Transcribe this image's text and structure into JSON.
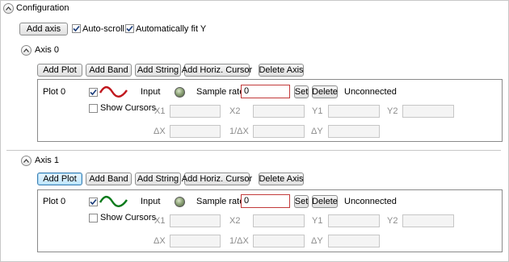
{
  "configuration": {
    "title": "Configuration",
    "add_axis_label": "Add axis",
    "auto_scroll_label": "Auto-scroll",
    "auto_scroll_checked": true,
    "auto_fit_label": "Automatically fit Y",
    "auto_fit_checked": true
  },
  "axes": [
    {
      "title": "Axis 0",
      "buttons": {
        "add_plot": "Add Plot",
        "add_band": "Add Band",
        "add_string": "Add String",
        "add_cursor": "Add Horiz. Cursor",
        "delete_axis": "Delete Axis"
      },
      "plot": {
        "name": "Plot 0",
        "enabled": true,
        "line_color": "#c0171d",
        "show_cursors_label": "Show Cursors",
        "input_label": "Input",
        "sample_rate_label": "Sample rate",
        "sample_rate_value": "0",
        "set_label": "Set",
        "delete_label": "Delete",
        "status": "Unconnected",
        "x1": "X1",
        "x2": "X2",
        "y1": "Y1",
        "y2": "Y2",
        "dx": "ΔX",
        "inv_dx": "1/ΔX",
        "dy": "ΔY"
      }
    },
    {
      "title": "Axis 1",
      "buttons": {
        "add_plot": "Add Plot",
        "add_band": "Add Band",
        "add_string": "Add String",
        "add_cursor": "Add Horiz. Cursor",
        "delete_axis": "Delete Axis"
      },
      "plot": {
        "name": "Plot 0",
        "enabled": true,
        "line_color": "#0b7a1b",
        "show_cursors_label": "Show Cursors",
        "input_label": "Input",
        "sample_rate_label": "Sample rate",
        "sample_rate_value": "0",
        "set_label": "Set",
        "delete_label": "Delete",
        "status": "Unconnected",
        "x1": "X1",
        "x2": "X2",
        "y1": "Y1",
        "y2": "Y2",
        "dx": "ΔX",
        "inv_dx": "1/ΔX",
        "dy": "ΔY"
      }
    }
  ],
  "icons": {
    "collapse": "chevron-up-icon",
    "check": "checkmark-icon",
    "led": "status-led-icon",
    "waveform": "sine-wave-icon"
  }
}
